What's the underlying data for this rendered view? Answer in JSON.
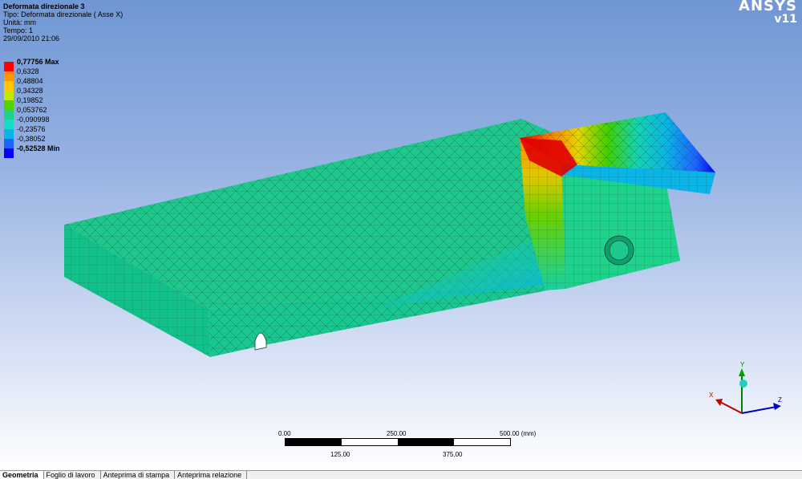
{
  "result": {
    "title": "Deformata direzionale 3",
    "type_line": "Tipo: Deformata direzionale ( Asse X)",
    "unit_line": "Unità: mm",
    "time_line": "Tempo: 1",
    "date_line": "29/09/2010 21:06"
  },
  "logo": {
    "brand": "ANSYS",
    "version": "v11"
  },
  "legend": [
    {
      "label": "0,77756 Max",
      "color": "#ff0000"
    },
    {
      "label": "0,6328",
      "color": "#ff9600"
    },
    {
      "label": "0,48804",
      "color": "#ffc800"
    },
    {
      "label": "0,34328",
      "color": "#c8e600"
    },
    {
      "label": "0,19852",
      "color": "#50d200"
    },
    {
      "label": "0,053762",
      "color": "#1ed28c"
    },
    {
      "label": "-0,090998",
      "color": "#14dcc8"
    },
    {
      "label": "-0,23576",
      "color": "#0ab4e6"
    },
    {
      "label": "-0,38052",
      "color": "#1e64ff"
    },
    {
      "label": "-0,52528 Min",
      "color": "#0000ff"
    }
  ],
  "scale": {
    "top_labels": [
      "0.00",
      "250.00",
      "500.00 (mm)"
    ],
    "bottom_labels": [
      "125.00",
      "375.00"
    ]
  },
  "triad": {
    "x_label": "X",
    "y_label": "Y",
    "z_label": "Z",
    "x_color": "#c00000",
    "y_color": "#008000",
    "z_color": "#0000c0"
  },
  "tabs": [
    {
      "label": "Geometria",
      "active": true
    },
    {
      "label": "Foglio di lavoro",
      "active": false
    },
    {
      "label": "Anteprima di stampa",
      "active": false
    },
    {
      "label": "Anteprima relazione",
      "active": false
    }
  ]
}
